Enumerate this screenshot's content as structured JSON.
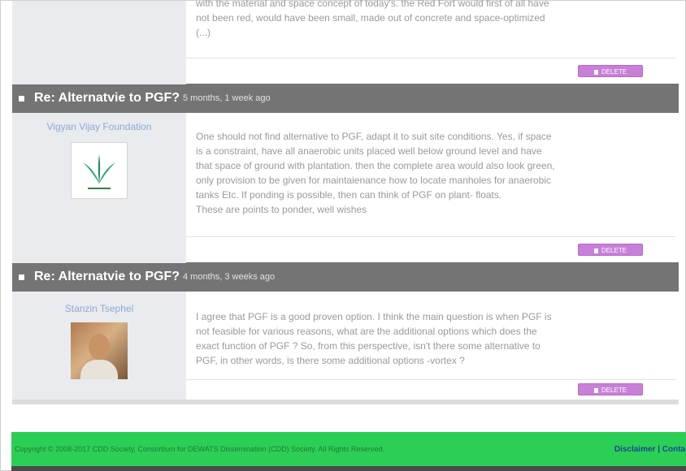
{
  "posts": [
    {
      "body": [
        "with the material and space concept of today's. the Red Fort would first of all have",
        "not been red, would have been small, made out of concrete and space-optimized",
        "(...)"
      ],
      "delete_label": "DELETE"
    },
    {
      "title": "Re: Alternatvie to PGF?",
      "time": "5 months, 1 week ago",
      "author": "Vigyan Vijay Foundation",
      "avatar": "leaf-logo",
      "body": [
        "One should not find alternative to PGF, adapt it to suit site conditions. Yes, if space",
        "is a constraint, have all anaerobic units placed well below ground level and have",
        "that space of ground with plantation. then the complete area would also look green,",
        "only provision to be given for maintaienance how to locate manholes for anaerobic",
        "tanks Etc. If ponding is possible, then can think of PGF on plant- floats.",
        "These are points to ponder, well wishes"
      ],
      "delete_label": "DELETE"
    },
    {
      "title": "Re: Alternatvie to PGF?",
      "time": "4 months, 3 weeks ago",
      "author": "Stanzin Tsephel",
      "avatar": "profile-photo",
      "body": [
        "I agree that PGF is a good proven option. I think the main question is when PGF is",
        "not feasible for various reasons, what are the additional options which does the",
        "exact function of PGF ? So, from this perspective, isn't there some alternative to",
        "PGF, in other words, is there some additional options -vortex ?"
      ],
      "delete_label": "DELETE"
    }
  ],
  "footer": {
    "copyright": "Copyright © 2008-2017 CDD Society, Consortium for DEWATS Dissemination (CDD) Society. All Rights Reserved.",
    "disclaimer": "Disclaimer | Contact"
  },
  "colors": {
    "header_bar": "#747474",
    "author_panel": "#e9ebef",
    "delete_button": "#c77fd7",
    "footer": "#2ccf55",
    "author_link": "#8fa9d1"
  }
}
